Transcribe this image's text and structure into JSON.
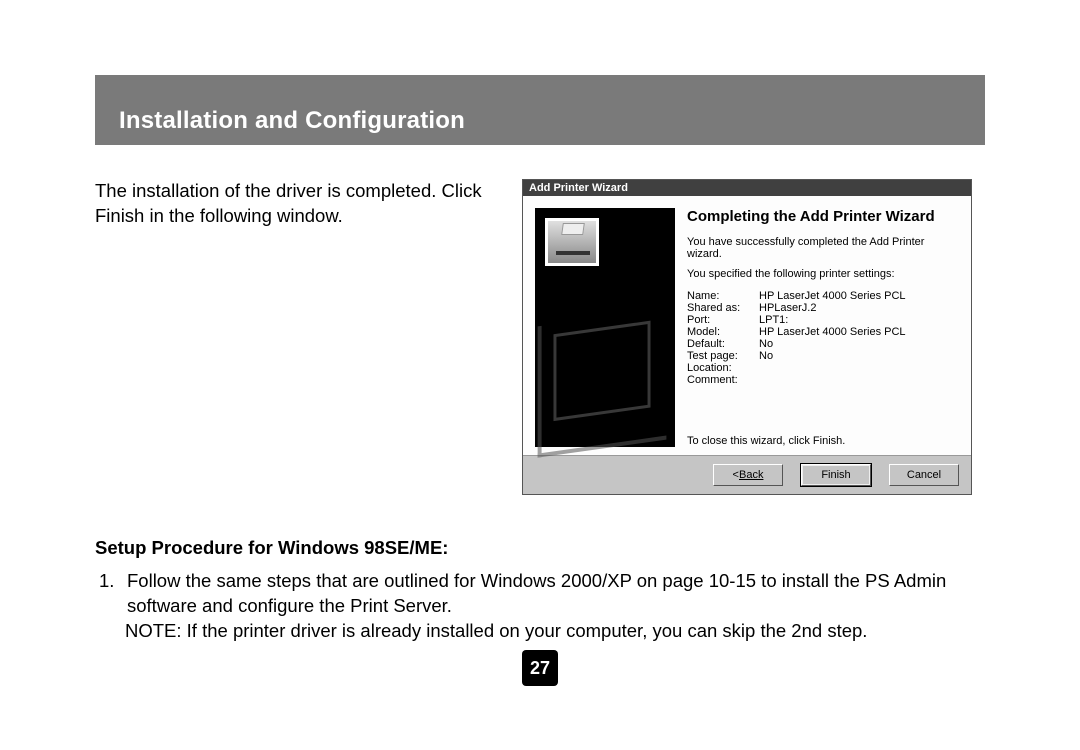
{
  "header": {
    "title": "Installation and Configuration"
  },
  "intro": "The installation of the driver is completed. Click Finish in the following window.",
  "wizard": {
    "titlebar": "Add Printer Wizard",
    "heading": "Completing the Add Printer Wizard",
    "success_msg": "You have successfully completed the Add Printer wizard.",
    "settings_intro": "You specified the following printer settings:",
    "settings": {
      "name_key": "Name:",
      "name_val": "HP LaserJet 4000 Series PCL",
      "shared_key": "Shared as:",
      "shared_val": "HPLaserJ.2",
      "port_key": "Port:",
      "port_val": "LPT1:",
      "model_key": "Model:",
      "model_val": "HP LaserJet 4000 Series PCL",
      "default_key": "Default:",
      "default_val": "No",
      "test_key": "Test page:",
      "test_val": "No",
      "location_key": "Location:",
      "location_val": "",
      "comment_key": "Comment:",
      "comment_val": ""
    },
    "close_hint": "To close this wizard, click Finish.",
    "buttons": {
      "back": "Back",
      "finish": "Finish",
      "cancel": "Cancel"
    }
  },
  "section2": {
    "heading": "Setup Procedure for Windows 98SE/ME:",
    "item_num": "1.",
    "item_text": "Follow the same steps that are outlined  for Windows 2000/XP on page 10-15 to install the PS Admin software and configure the Print Server.",
    "note": "NOTE: If the printer driver is already installed on your computer, you can skip the 2nd step."
  },
  "page_number": "27"
}
